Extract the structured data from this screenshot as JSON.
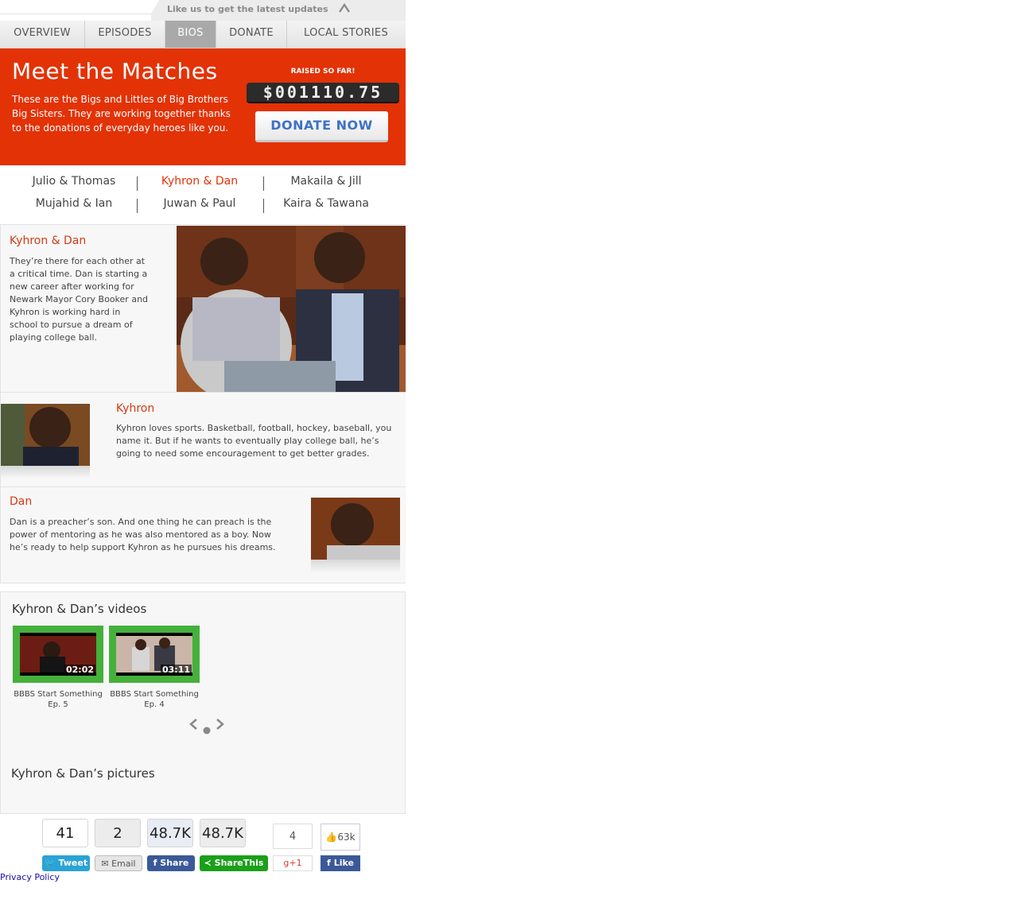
{
  "topbar": {
    "promo_text": "Like us to get the latest updates",
    "collapse_icon": "caret-up-icon"
  },
  "nav": {
    "items": [
      {
        "label": "OVERVIEW"
      },
      {
        "label": "EPISODES"
      },
      {
        "label": "BIOS",
        "active": true
      },
      {
        "label": "DONATE"
      },
      {
        "label": "LOCAL STORIES"
      }
    ]
  },
  "hero": {
    "title": "Meet the Matches",
    "text": "These are the Bigs and Littles of Big Brothers Big Sisters. They are working together thanks to the donations of everyday heroes like you.",
    "raised_label": "RAISED SO FAR!",
    "raised_amount": "$001110.75",
    "donate_label": "DONATE NOW",
    "accent_color": "#e33206"
  },
  "matches": {
    "rows": [
      [
        "Julio & Thomas",
        "Kyhron & Dan",
        "Makaila & Jill"
      ],
      [
        "Mujahid & Ian",
        "Juwan & Paul",
        "Kaira & Tawana"
      ]
    ],
    "active": "Kyhron & Dan"
  },
  "pair": {
    "title": "Kyhron & Dan",
    "text": "They’re there for each other at a critical time. Dan is starting a new career after working for Newark Mayor Cory Booker and Kyhron is working hard in school to pursue a dream of playing college ball."
  },
  "little": {
    "name": "Kyhron",
    "text": "Kyhron loves sports. Basketball, football, hockey, baseball, you name it. But if he wants to eventually play college ball, he’s going to need some encouragement to get better grades."
  },
  "big": {
    "name": "Dan",
    "text": "Dan is a preacher’s son. And one thing he can preach is the power of mentoring as he was also mentored as a boy. Now he’s ready to help support Kyhron as he pursues his dreams."
  },
  "videos": {
    "title": "Kyhron & Dan’s videos",
    "items": [
      {
        "duration": "02:02",
        "caption": "BBBS Start Something Ep. 5"
      },
      {
        "duration": "03:11",
        "caption": "BBBS Start Something Ep. 4"
      }
    ],
    "pager": {
      "prev_icon": "chevron-left-icon",
      "dot_icon": "dot-icon",
      "next_icon": "chevron-right-icon"
    }
  },
  "pictures": {
    "title": "Kyhron & Dan’s pictures"
  },
  "share": {
    "tweet_count": "41",
    "tweet_label": "Tweet",
    "email_count": "2",
    "email_label": "Email",
    "fb_share_count": "48.7K",
    "fb_share_label": "Share",
    "sharethis_count": "48.7K",
    "sharethis_label": "ShareThis",
    "gplus_count": "4",
    "gplus_label": "+1",
    "like_count": "63k",
    "like_label": "Like"
  },
  "footer": {
    "privacy_label": "Privacy Policy"
  }
}
